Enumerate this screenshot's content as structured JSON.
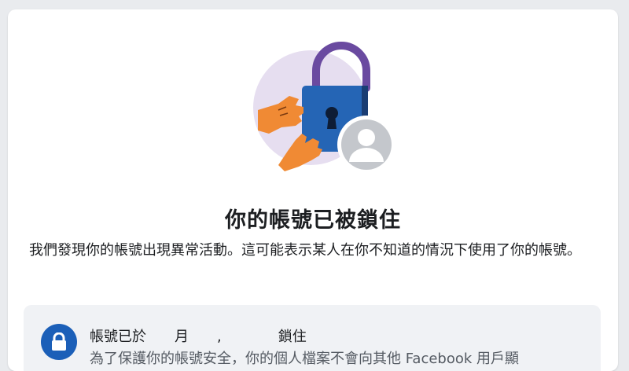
{
  "page": {
    "title": "你的帳號已被鎖住",
    "description": "我們發現你的帳號出現異常活動。這可能表示某人在你不知道的情況下使用了你的帳號。"
  },
  "illustration": {
    "icon": "locked-account-illustration",
    "colors": {
      "circle": "#e6def0",
      "lock_body": "#2565b5",
      "lock_shackle": "#6a4aa0",
      "hands": "#f08a34",
      "avatar": "#c4c7cc"
    }
  },
  "notice": {
    "title": "帳號已於　　月　　,　　　　鎖住",
    "body": "為了保護你的帳號安全，你的個人檔案不會向其他 Facebook 用戶顯",
    "icon": "lock-icon",
    "icon_color": "#1b5fb8"
  }
}
